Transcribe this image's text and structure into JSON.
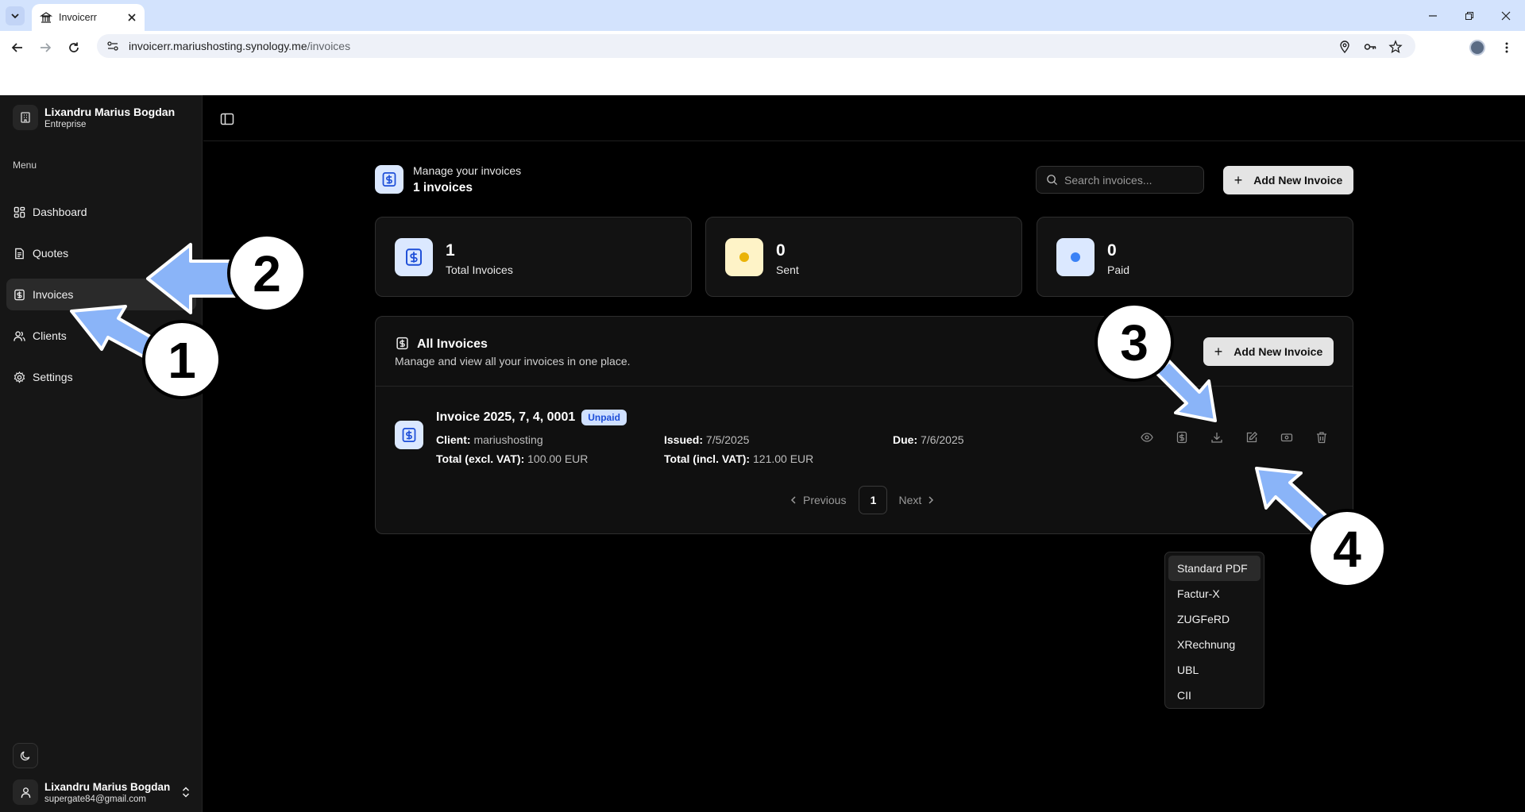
{
  "browser": {
    "tab_title": "Invoicerr",
    "url_host": "invoicerr.mariushosting.synology.me",
    "url_path": "/invoices"
  },
  "sidebar": {
    "org_name": "Lixandru Marius Bogdan",
    "org_sub": "Entreprise",
    "menu_label": "Menu",
    "items": [
      {
        "label": "Dashboard",
        "icon": "dashboard-icon"
      },
      {
        "label": "Quotes",
        "icon": "document-icon"
      },
      {
        "label": "Invoices",
        "icon": "invoice-icon"
      },
      {
        "label": "Clients",
        "icon": "users-icon"
      },
      {
        "label": "Settings",
        "icon": "gear-icon"
      }
    ],
    "user_name": "Lixandru Marius Bogdan",
    "user_email": "supergate84@gmail.com"
  },
  "header": {
    "subtitle": "Manage your invoices",
    "count": "1 invoices",
    "search_placeholder": "Search invoices...",
    "add_label": "Add New Invoice"
  },
  "stats": [
    {
      "value": "1",
      "label": "Total Invoices",
      "color": "#dbe8ff"
    },
    {
      "value": "0",
      "label": "Sent",
      "color": "#fef3c7"
    },
    {
      "value": "0",
      "label": "Paid",
      "color": "#dbe8ff"
    }
  ],
  "panel": {
    "title": "All Invoices",
    "description": "Manage and view all your invoices in one place.",
    "add_label": "Add New Invoice"
  },
  "invoice": {
    "title": "Invoice 2025, 7, 4, 0001",
    "status": "Unpaid",
    "client_label": "Client:",
    "client": "mariushosting",
    "issued_label": "Issued:",
    "issued": "7/5/2025",
    "due_label": "Due:",
    "due": "7/6/2025",
    "total_excl_label": "Total (excl. VAT):",
    "total_excl": "100.00 EUR",
    "total_incl_label": "Total (incl. VAT):",
    "total_incl": "121.00 EUR"
  },
  "pagination": {
    "previous": "Previous",
    "page": "1",
    "next": "Next"
  },
  "download_menu": [
    "Standard PDF",
    "Factur-X",
    "ZUGFeRD",
    "XRechnung",
    "UBL",
    "CII"
  ],
  "annotations": [
    "1",
    "2",
    "3",
    "4"
  ],
  "colors": {
    "accent_blue": "#1d4ed8",
    "arrow_blue": "#8ab4f8",
    "sent_dot": "#eab308",
    "paid_dot": "#3b82f6"
  }
}
